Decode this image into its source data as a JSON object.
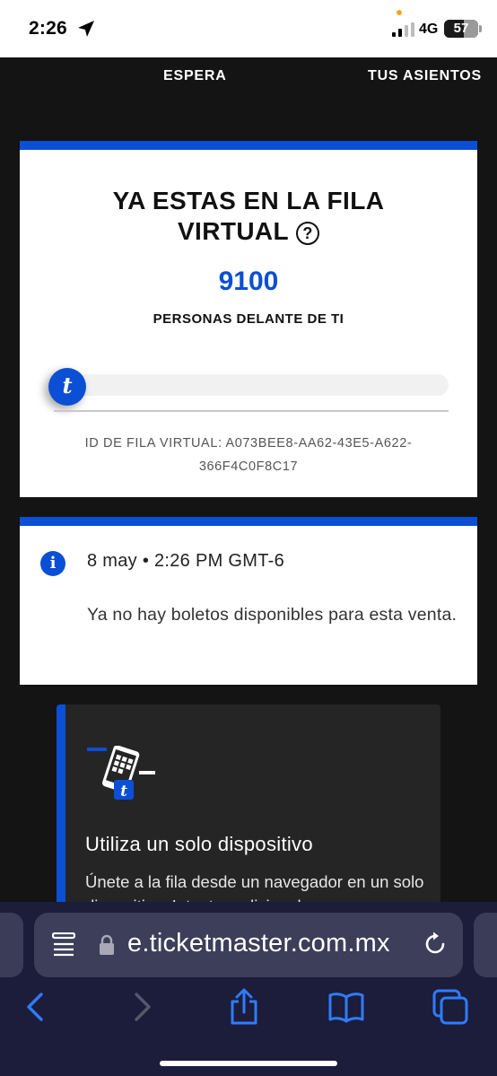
{
  "status_bar": {
    "time": "2:26",
    "network": "4G",
    "battery": "57",
    "battery_level": 0.57
  },
  "tabs": {
    "espera": "ESPERA",
    "asientos": "TUS ASIENTOS"
  },
  "queue": {
    "title_line1": "YA ESTAS EN LA FILA",
    "title_line2": "VIRTUAL",
    "help_glyph": "?",
    "count": "9100",
    "count_label": "PERSONAS DELANTE DE TI",
    "progress": 0.02,
    "knob_letter": "t",
    "id_text": "ID DE FILA VIRTUAL: A073BEE8-AA62-43E5-A622-366F4C0F8C17"
  },
  "info": {
    "icon_glyph": "i",
    "date": "8 may • 2:26 PM GMT-6",
    "message": "Ya no hay boletos disponibles para esta venta."
  },
  "tip": {
    "title": "Utiliza un solo dispositivo",
    "body": "Únete a la fila desde un navegador en un solo dispositivo. Intentos adicionales"
  },
  "browser": {
    "url": "e.ticketmaster.com.mx"
  },
  "colors": {
    "brand_blue": "#0b4fd4",
    "safari_bar": "#1b1d3a",
    "page_bg": "#141414"
  },
  "icons": {
    "location": "location-arrow-icon",
    "signal": "signal-bars-icon",
    "reader": "reader-mode-icon",
    "lock": "lock-icon",
    "reload": "reload-icon",
    "back": "back-chevron-icon",
    "forward": "forward-chevron-icon",
    "share": "share-icon",
    "bookmarks": "book-icon",
    "tabs": "tabs-icon"
  }
}
